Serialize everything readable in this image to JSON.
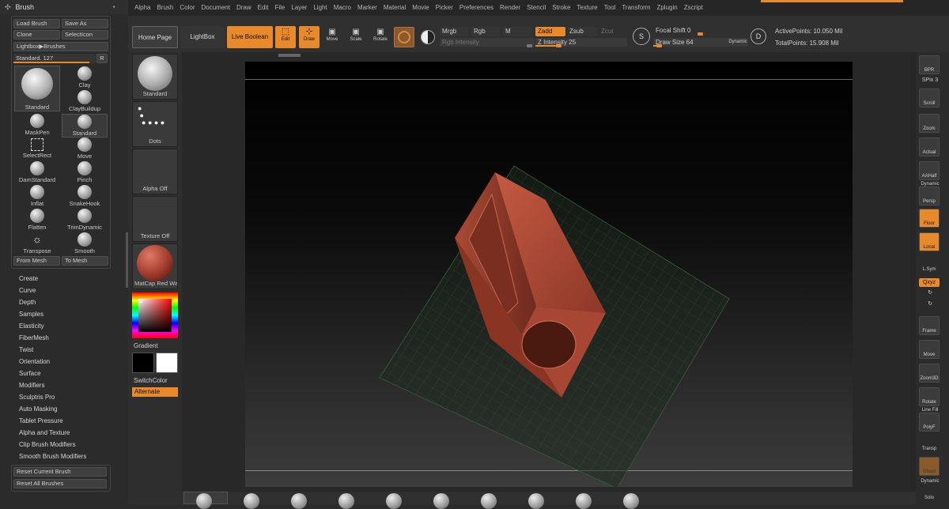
{
  "menu": [
    "Alpha",
    "Brush",
    "Color",
    "Document",
    "Draw",
    "Edit",
    "File",
    "Layer",
    "Light",
    "Macro",
    "Marker",
    "Material",
    "Movie",
    "Picker",
    "Preferences",
    "Render",
    "Stencil",
    "Stroke",
    "Texture",
    "Tool",
    "Transform",
    "Zplugin",
    "Zscript"
  ],
  "brush_panel": {
    "title": "Brush",
    "load_brush": "Load Brush",
    "save_as": "Save As",
    "clone": "Clone",
    "select_icon": "SelectIcon",
    "lightbox_brushes": "Lightbox▶Brushes",
    "standard_slider": "Standard. 127",
    "r_button": "R",
    "current_brush": "Standard",
    "brushes": [
      "Clay",
      "ClayBuildup",
      "MaskPen",
      "Standard",
      "SelectRect",
      "Move",
      "DamStandard",
      "Pinch",
      "Inflat",
      "SnakeHook",
      "Flatten",
      "TrimDynamic",
      "Transpose",
      "Smooth"
    ],
    "from_mesh": "From Mesh",
    "to_mesh": "To Mesh",
    "subpalettes": [
      "Create",
      "Curve",
      "Depth",
      "Samples",
      "Elasticity",
      "FiberMesh",
      "Twist",
      "Orientation",
      "Surface",
      "Modifiers",
      "Sculptris Pro",
      "Auto Masking",
      "Tablet Pressure",
      "Alpha and Texture",
      "Clip Brush Modifiers",
      "Smooth Brush Modifiers"
    ],
    "reset_current": "Reset Current Brush",
    "reset_all": "Reset All Brushes"
  },
  "toolbar": {
    "home_page": "Home Page",
    "lightbox": "LightBox",
    "live_boolean": "Live Boolean",
    "edit": "Edit",
    "draw": "Draw",
    "move": "Move",
    "scale": "Scale",
    "rotate": "Rotate",
    "mrgb": "Mrgb",
    "rgb": "Rgb",
    "m": "M",
    "zadd": "Zadd",
    "zsub": "Zsub",
    "zcut": "Zcut",
    "rgb_intensity": "Rgb Intensity",
    "z_intensity": "Z Intensity 25",
    "focal_shift": "Focal Shift 0",
    "draw_size": "Draw Size 64",
    "dynamic": "Dynamic",
    "active_points": "ActivePoints: 10.050 Mil",
    "total_points": "TotalPoints: 15.908 Mil",
    "z_intensity_level": 0.25,
    "draw_size_level": 0.06
  },
  "shelf": {
    "brush": "Standard",
    "stroke": "Dots",
    "alpha": "Alpha Off",
    "texture": "Texture Off",
    "material": "MatCap Red Wax",
    "gradient": "Gradient",
    "switch_color": "SwitchColor",
    "alternate": "Alternate"
  },
  "right_panel": {
    "bpr": "BPR",
    "spix": "SPix 3",
    "scroll": "Scroll",
    "zoom": "Zoom",
    "actual": "Actual",
    "aahalf": "AAHalf",
    "dynamic": "Dynamic",
    "persp": "Persp",
    "floor": "Floor",
    "local": "Local",
    "lsym": "L.Sym",
    "xyz": "Qxyz",
    "frame": "Frame",
    "move": "Move",
    "zoom3d": "Zoom3D",
    "rotate": "Rotate",
    "linefill": "Line Fill",
    "polyf": "PolyF",
    "transp": "Transp",
    "ghost": "Ghost",
    "dynamic2": "Dynamic",
    "solo": "Solo"
  },
  "colors": {
    "accent": "#e8892a",
    "model": "#b5523c",
    "panel": "#2b2b2b"
  }
}
